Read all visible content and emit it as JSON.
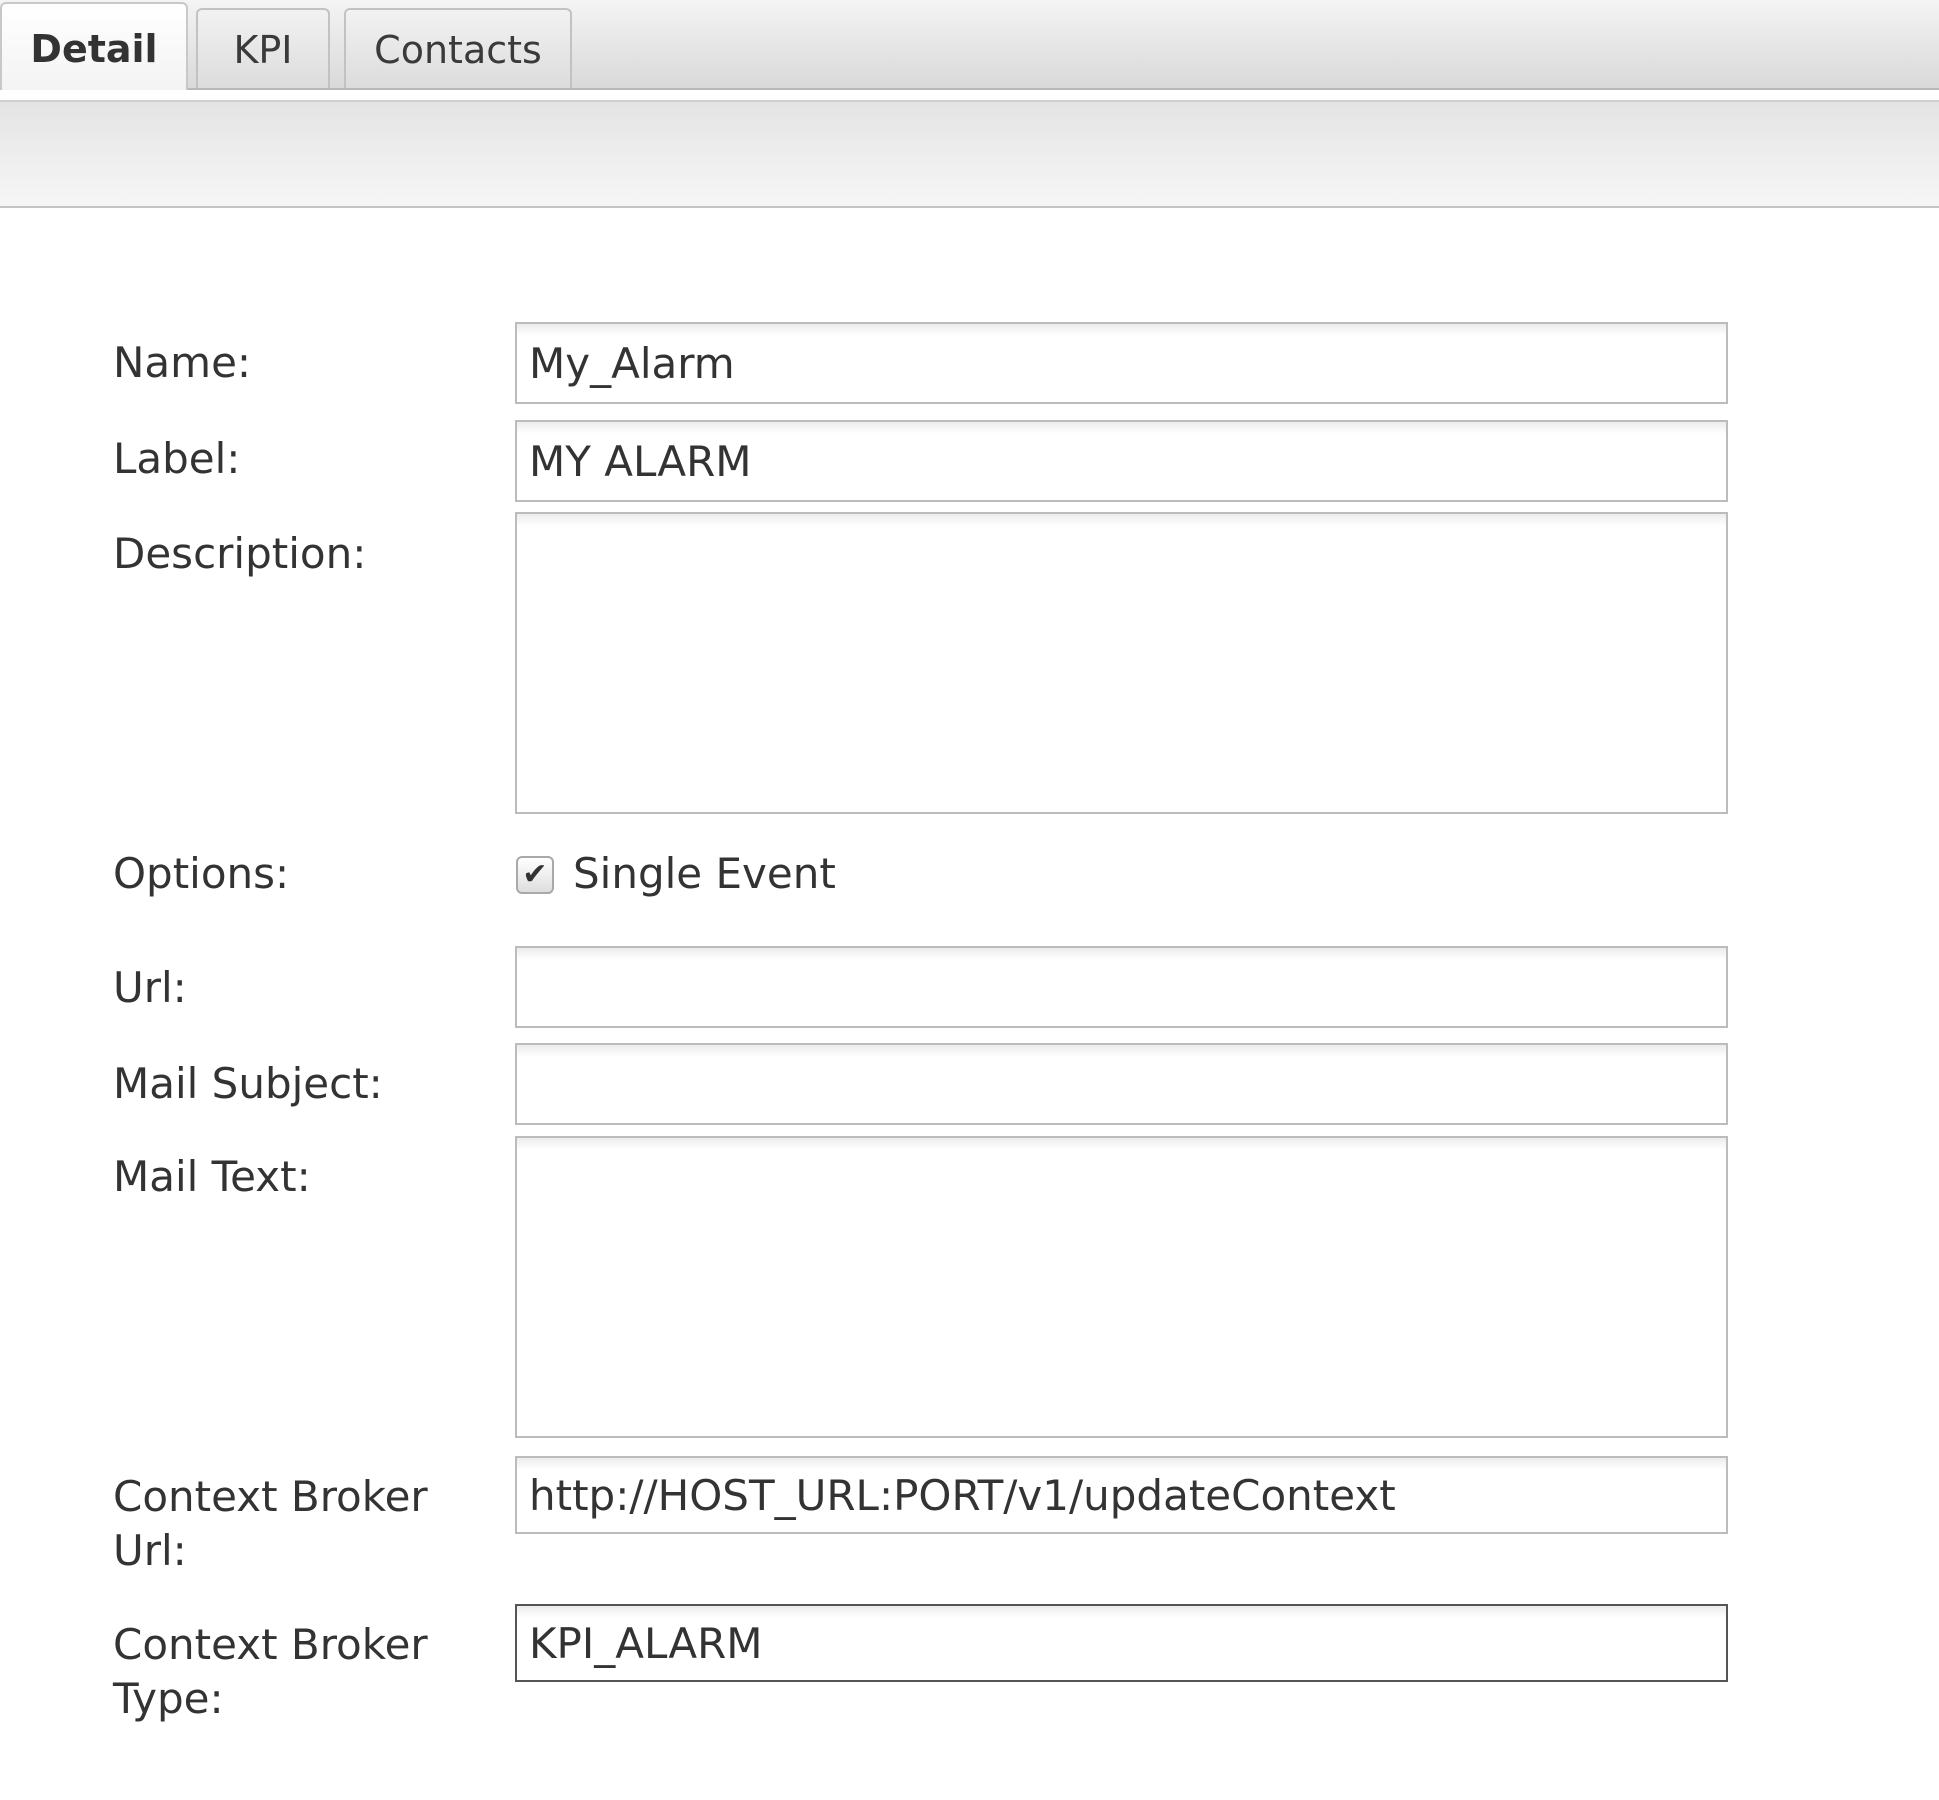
{
  "tabs": [
    {
      "label": "Detail",
      "active": true
    },
    {
      "label": "KPI",
      "active": false
    },
    {
      "label": "Contacts",
      "active": false
    }
  ],
  "form": {
    "name": {
      "label": "Name:",
      "value": "My_Alarm"
    },
    "label_field": {
      "label": "Label:",
      "value": "MY ALARM"
    },
    "description": {
      "label": "Description:",
      "value": ""
    },
    "options": {
      "label": "Options:",
      "single_event_label": "Single Event",
      "single_event_checked": true
    },
    "url": {
      "label": "Url:",
      "value": ""
    },
    "mail_subject": {
      "label": "Mail Subject:",
      "value": ""
    },
    "mail_text": {
      "label": "Mail Text:",
      "value": ""
    },
    "context_broker_url": {
      "label_line1": "Context Broker",
      "label_line2": "Url:",
      "value": "http://HOST_URL:PORT/v1/updateContext"
    },
    "context_broker_type": {
      "label_line1": "Context Broker",
      "label_line2": "Type:",
      "value": "KPI_ALARM"
    }
  },
  "icons": {
    "checkmark": "check-icon"
  }
}
